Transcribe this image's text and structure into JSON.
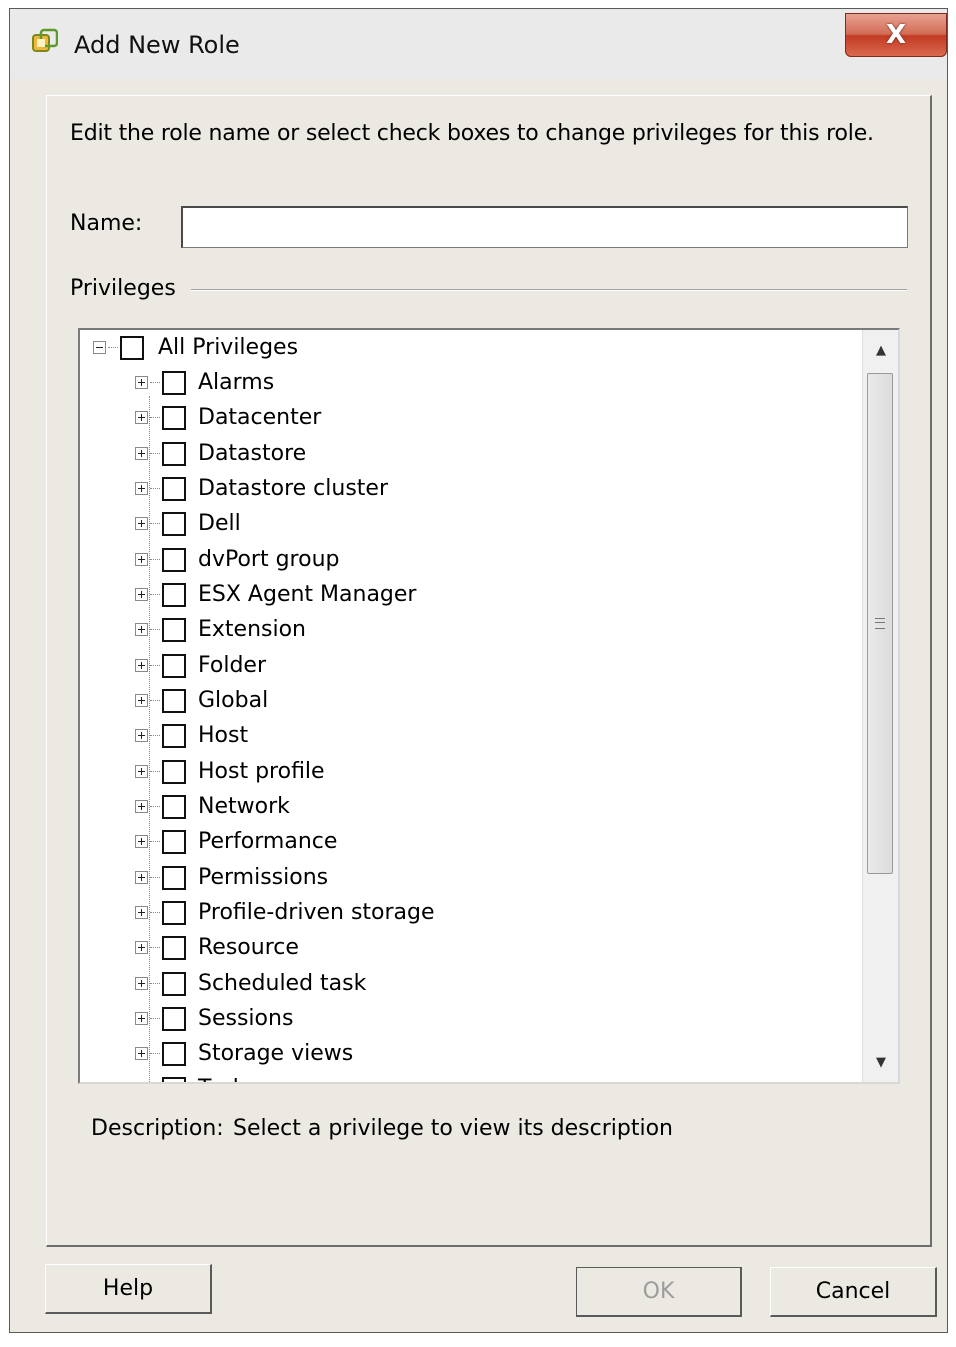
{
  "window": {
    "title": "Add New Role",
    "close_label": "X"
  },
  "instructions": "Edit the role name or select check boxes to change privileges for this role.",
  "name_field": {
    "label": "Name:",
    "value": "",
    "placeholder": ""
  },
  "privileges": {
    "group_label": "Privileges",
    "root": {
      "label": "All Privileges",
      "checked": false,
      "expanded": true
    },
    "items": [
      {
        "label": "Alarms"
      },
      {
        "label": "Datacenter"
      },
      {
        "label": "Datastore"
      },
      {
        "label": "Datastore cluster"
      },
      {
        "label": "Dell"
      },
      {
        "label": "dvPort group"
      },
      {
        "label": "ESX Agent Manager"
      },
      {
        "label": "Extension"
      },
      {
        "label": "Folder"
      },
      {
        "label": "Global"
      },
      {
        "label": "Host"
      },
      {
        "label": "Host profile"
      },
      {
        "label": "Network"
      },
      {
        "label": "Performance"
      },
      {
        "label": "Permissions"
      },
      {
        "label": "Profile-driven storage"
      },
      {
        "label": "Resource"
      },
      {
        "label": "Scheduled task"
      },
      {
        "label": "Sessions"
      },
      {
        "label": "Storage views"
      },
      {
        "label": "Tasks"
      }
    ]
  },
  "description": {
    "label": "Description:",
    "value": "Select a privilege to view its description"
  },
  "buttons": {
    "help": "Help",
    "ok": "OK",
    "cancel": "Cancel"
  },
  "colors": {
    "close_button": "#c23b22",
    "dialog_background": "#ece9e2",
    "disabled_text": "#9c9c9c"
  },
  "icons": {
    "app": "vsphere-client-icon",
    "close": "close-icon",
    "expand": "plus-box-icon",
    "collapse": "minus-box-icon"
  }
}
